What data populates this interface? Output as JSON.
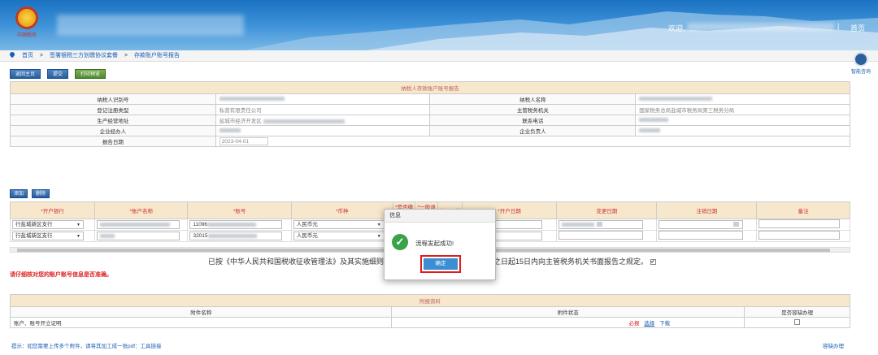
{
  "header": {
    "emblem_text": "中国税务",
    "welcome": "欢迎,",
    "separator": "|",
    "home_link": "首页"
  },
  "breadcrumb": {
    "items": [
      "首页",
      "签署银税三方划缴协议套餐",
      "存款账户账号报告"
    ],
    "separator": ">"
  },
  "help": {
    "label": "智能咨询"
  },
  "toolbar": {
    "back": "返回主页",
    "submit": "提交",
    "print": "打印预览"
  },
  "report": {
    "caption": "纳税人存款账户账号报告",
    "rows": [
      {
        "l1": "纳税人识别号",
        "v1": "",
        "l2": "纳税人名称",
        "v2": ""
      },
      {
        "l1": "登记注册类型",
        "v1": "私营有限责任公司",
        "l2": "主管税务机关",
        "v2": "国家税务总局盐城市税务局第三税务分局"
      },
      {
        "l1": "生产经营地址",
        "v1": "盐城市经济开发区",
        "l2": "联系电话",
        "v2": ""
      },
      {
        "l1": "企业经办人",
        "v1": "",
        "l2": "企业负责人",
        "v2": ""
      }
    ],
    "date_label": "报告日期",
    "date_value": "2023-04-01"
  },
  "actions": {
    "add": "添加",
    "delete": "删除"
  },
  "accounts": {
    "headers": [
      "*开户银行",
      "*账户名称",
      "*账号",
      "*币种",
      "*是否缴税",
      "*一般退税",
      "出口退税",
      "*开户日期",
      "变更日期",
      "注销日期",
      "备注"
    ],
    "rows": [
      {
        "bank": "行盐城新区支行",
        "account": "11096",
        "currency": "人民币元",
        "open_date": "1-01-14"
      },
      {
        "bank": "行盐城新区支行",
        "account": "32015",
        "currency": "人民币元",
        "open_date": "3-04-01"
      }
    ]
  },
  "statement": {
    "left": "已按《中华人民共和国税收征收管理法》及其实施细则规",
    "right": "之日起15日内向主管税务机关书面报告之规定。"
  },
  "warning": "请仔细核对您的账户账号信息是否准确。",
  "attachments": {
    "caption": "附报资料",
    "headers": [
      "附件名称",
      "附件状态",
      "是否容缺办理"
    ],
    "rows": [
      {
        "name": "账户、账号开立证明",
        "required": "必报",
        "select": "选择",
        "download": "下载"
      }
    ]
  },
  "tip": "提示：如您需要上传多个附件，请将其加工成一张pdf：工具链接",
  "tip_right": "容缺办理",
  "dialog": {
    "title": "信息",
    "message": "流程发起成功!",
    "ok": "确定"
  }
}
